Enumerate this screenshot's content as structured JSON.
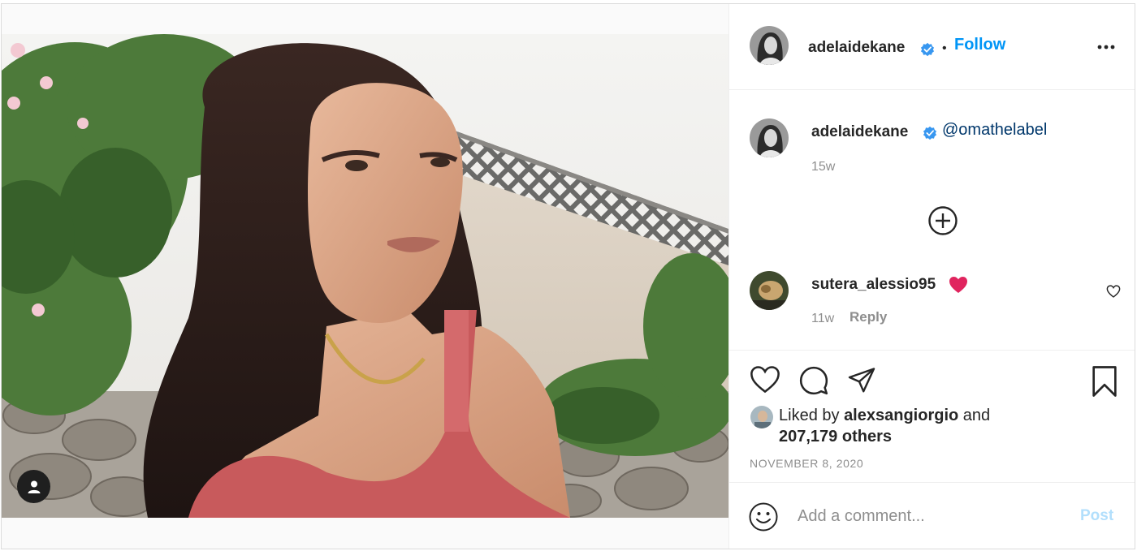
{
  "post": {
    "author": {
      "username": "adelaidekane",
      "verified": true,
      "follow_label": "Follow",
      "separator": "•"
    },
    "caption": {
      "username": "adelaidekane",
      "mention": "@omathelabel",
      "time": "15w"
    },
    "comments": [
      {
        "username": "sutera_alessio95",
        "emoji": "heart",
        "time": "11w",
        "reply_label": "Reply"
      }
    ],
    "likes": {
      "prefix": "Liked by",
      "liker": "alexsangiorgio",
      "conjunction": "and",
      "others": "207,179 others"
    },
    "date": "NOVEMBER 8, 2020",
    "comment_box": {
      "placeholder": "Add a comment...",
      "post_label": "Post"
    }
  },
  "icons": {
    "header": [
      "more-options-icon"
    ],
    "actions": [
      "like-icon",
      "comment-icon",
      "share-icon",
      "save-icon"
    ],
    "misc": [
      "verified-badge-icon",
      "load-more-comments-icon",
      "comment-like-icon",
      "emoji-icon",
      "tagged-user-icon"
    ]
  },
  "colors": {
    "link_blue": "#0095f6",
    "mention_blue": "#00376b",
    "muted": "#8e8e8e",
    "post_disabled": "#b2dffc",
    "verified": "#3897f0",
    "heart_red": "#e0245e"
  }
}
